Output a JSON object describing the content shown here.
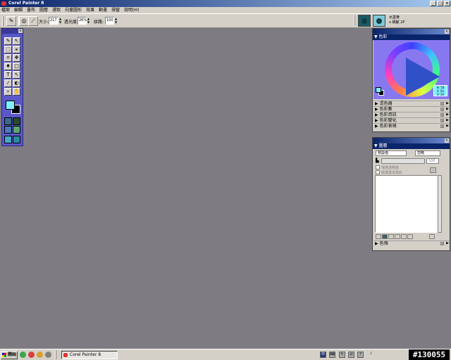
{
  "window": {
    "title": "Corel Painter 8"
  },
  "menu": [
    "檔案",
    "編輯",
    "畫布",
    "圖層",
    "選取",
    "向量圖形",
    "效果",
    "動畫",
    "視窗",
    "說明(H)"
  ],
  "property_bar": {
    "size_label": "大小:",
    "size_value": "217",
    "opacity_label": "透光度:",
    "opacity_value": "26%",
    "grain_label": "紋路:",
    "grain_value": "100"
  },
  "brush_selector": {
    "category": "水墨筆",
    "variant": "x 細膩 2P"
  },
  "color_panel": {
    "title": "色彩",
    "readout": [
      "H: 56",
      "S: 62",
      "V: 20"
    ],
    "sub_palettes": [
      "混色器",
      "色彩集",
      "色彩資訊",
      "色彩變化",
      "色彩表現"
    ]
  },
  "layers_panel": {
    "title": "圖層",
    "composite_method": "預設值",
    "composite_depth": "忽略",
    "opacity": "100",
    "option1": "保持透明度",
    "option2": "挑選基本色彩",
    "footer": "色頻"
  },
  "taskbar": {
    "start_label": "開始",
    "task_item": "Corel Painter 8",
    "clock_text": "#130055"
  },
  "colors": {
    "canvas": "#7e7c82",
    "toolbox": "#5a58c8",
    "titlebar": "#0a246a"
  }
}
